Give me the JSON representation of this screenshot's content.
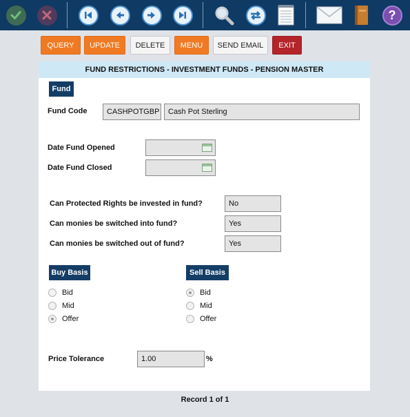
{
  "toolbar": {
    "icons": [
      "confirm-icon",
      "cancel-icon",
      "first-record-icon",
      "previous-record-icon",
      "next-record-icon",
      "last-record-icon",
      "search-icon",
      "refresh-icon",
      "notepad-icon",
      "mail-icon",
      "book-icon",
      "help-icon"
    ]
  },
  "actions": {
    "query": "QUERY",
    "update": "UPDATE",
    "delete": "DELETE",
    "menu": "MENU",
    "send_email": "SEND EMAIL",
    "exit": "EXIT"
  },
  "panel": {
    "title": "FUND RESTRICTIONS - INVESTMENT FUNDS - PENSION MASTER"
  },
  "fund": {
    "section": "Fund",
    "code_label": "Fund Code",
    "code_value": "CASHPOTGBP",
    "name_value": "Cash Pot Sterling",
    "opened_label": "Date Fund Opened",
    "opened_value": "",
    "closed_label": "Date Fund Closed",
    "closed_value": ""
  },
  "questions": [
    {
      "label": "Can Protected Rights be invested in fund?",
      "value": "No"
    },
    {
      "label": "Can monies be switched into fund?",
      "value": "Yes"
    },
    {
      "label": "Can monies be switched out of fund?",
      "value": "Yes"
    }
  ],
  "buy_basis": {
    "section": "Buy Basis",
    "options": [
      "Bid",
      "Mid",
      "Offer"
    ],
    "selected": "Offer"
  },
  "sell_basis": {
    "section": "Sell Basis",
    "options": [
      "Bid",
      "Mid",
      "Offer"
    ],
    "selected": "Bid"
  },
  "price_tolerance": {
    "label": "Price Tolerance",
    "value": "1.00",
    "unit": "%"
  },
  "footer": {
    "record": "Record 1 of 1"
  },
  "colors": {
    "toolbar": "#0f3a63",
    "orange": "#f07a23",
    "exit": "#b3252a",
    "section": "#143d66",
    "title_band": "#cfe8f6"
  }
}
